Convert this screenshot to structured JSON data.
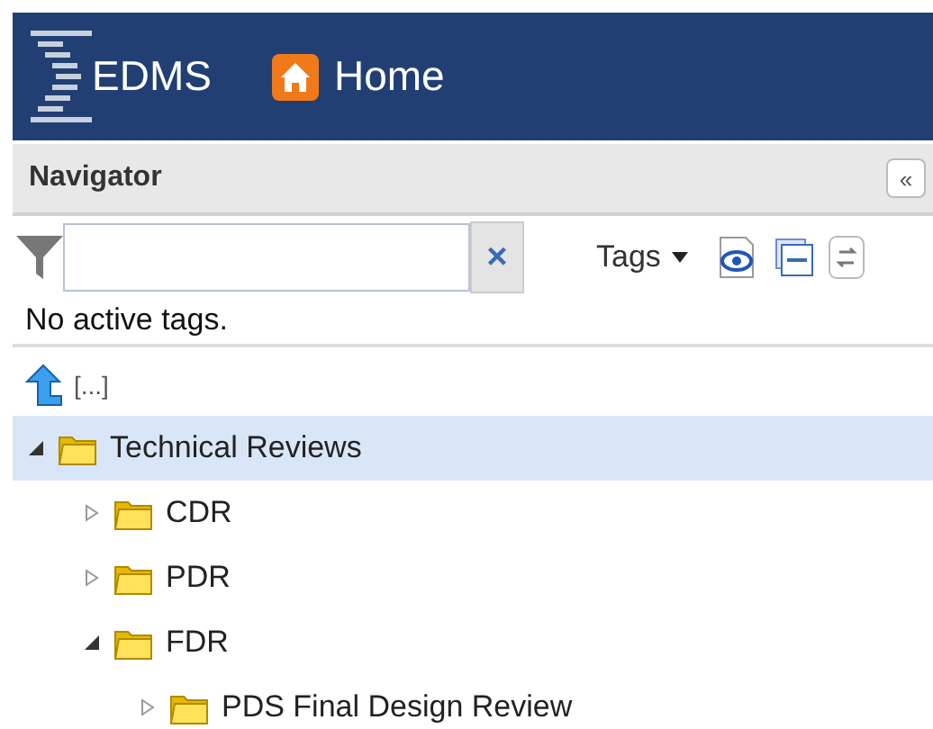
{
  "header": {
    "logo": "EDMS",
    "home": "Home"
  },
  "navigator": {
    "title": "Navigator",
    "collapse": "«"
  },
  "toolbar": {
    "clear": "×",
    "tags": "Tags"
  },
  "status": "No active tags.",
  "up": {
    "label": "[...]"
  },
  "tree": [
    {
      "label": "Technical Reviews",
      "expanded": true,
      "selected": true,
      "children": [
        {
          "label": "CDR",
          "expanded": false,
          "selected": false
        },
        {
          "label": "PDR",
          "expanded": false,
          "selected": false
        },
        {
          "label": "FDR",
          "expanded": true,
          "selected": false,
          "children": [
            {
              "label": "PDS Final Design Review",
              "expanded": false,
              "selected": false
            }
          ]
        }
      ]
    }
  ]
}
